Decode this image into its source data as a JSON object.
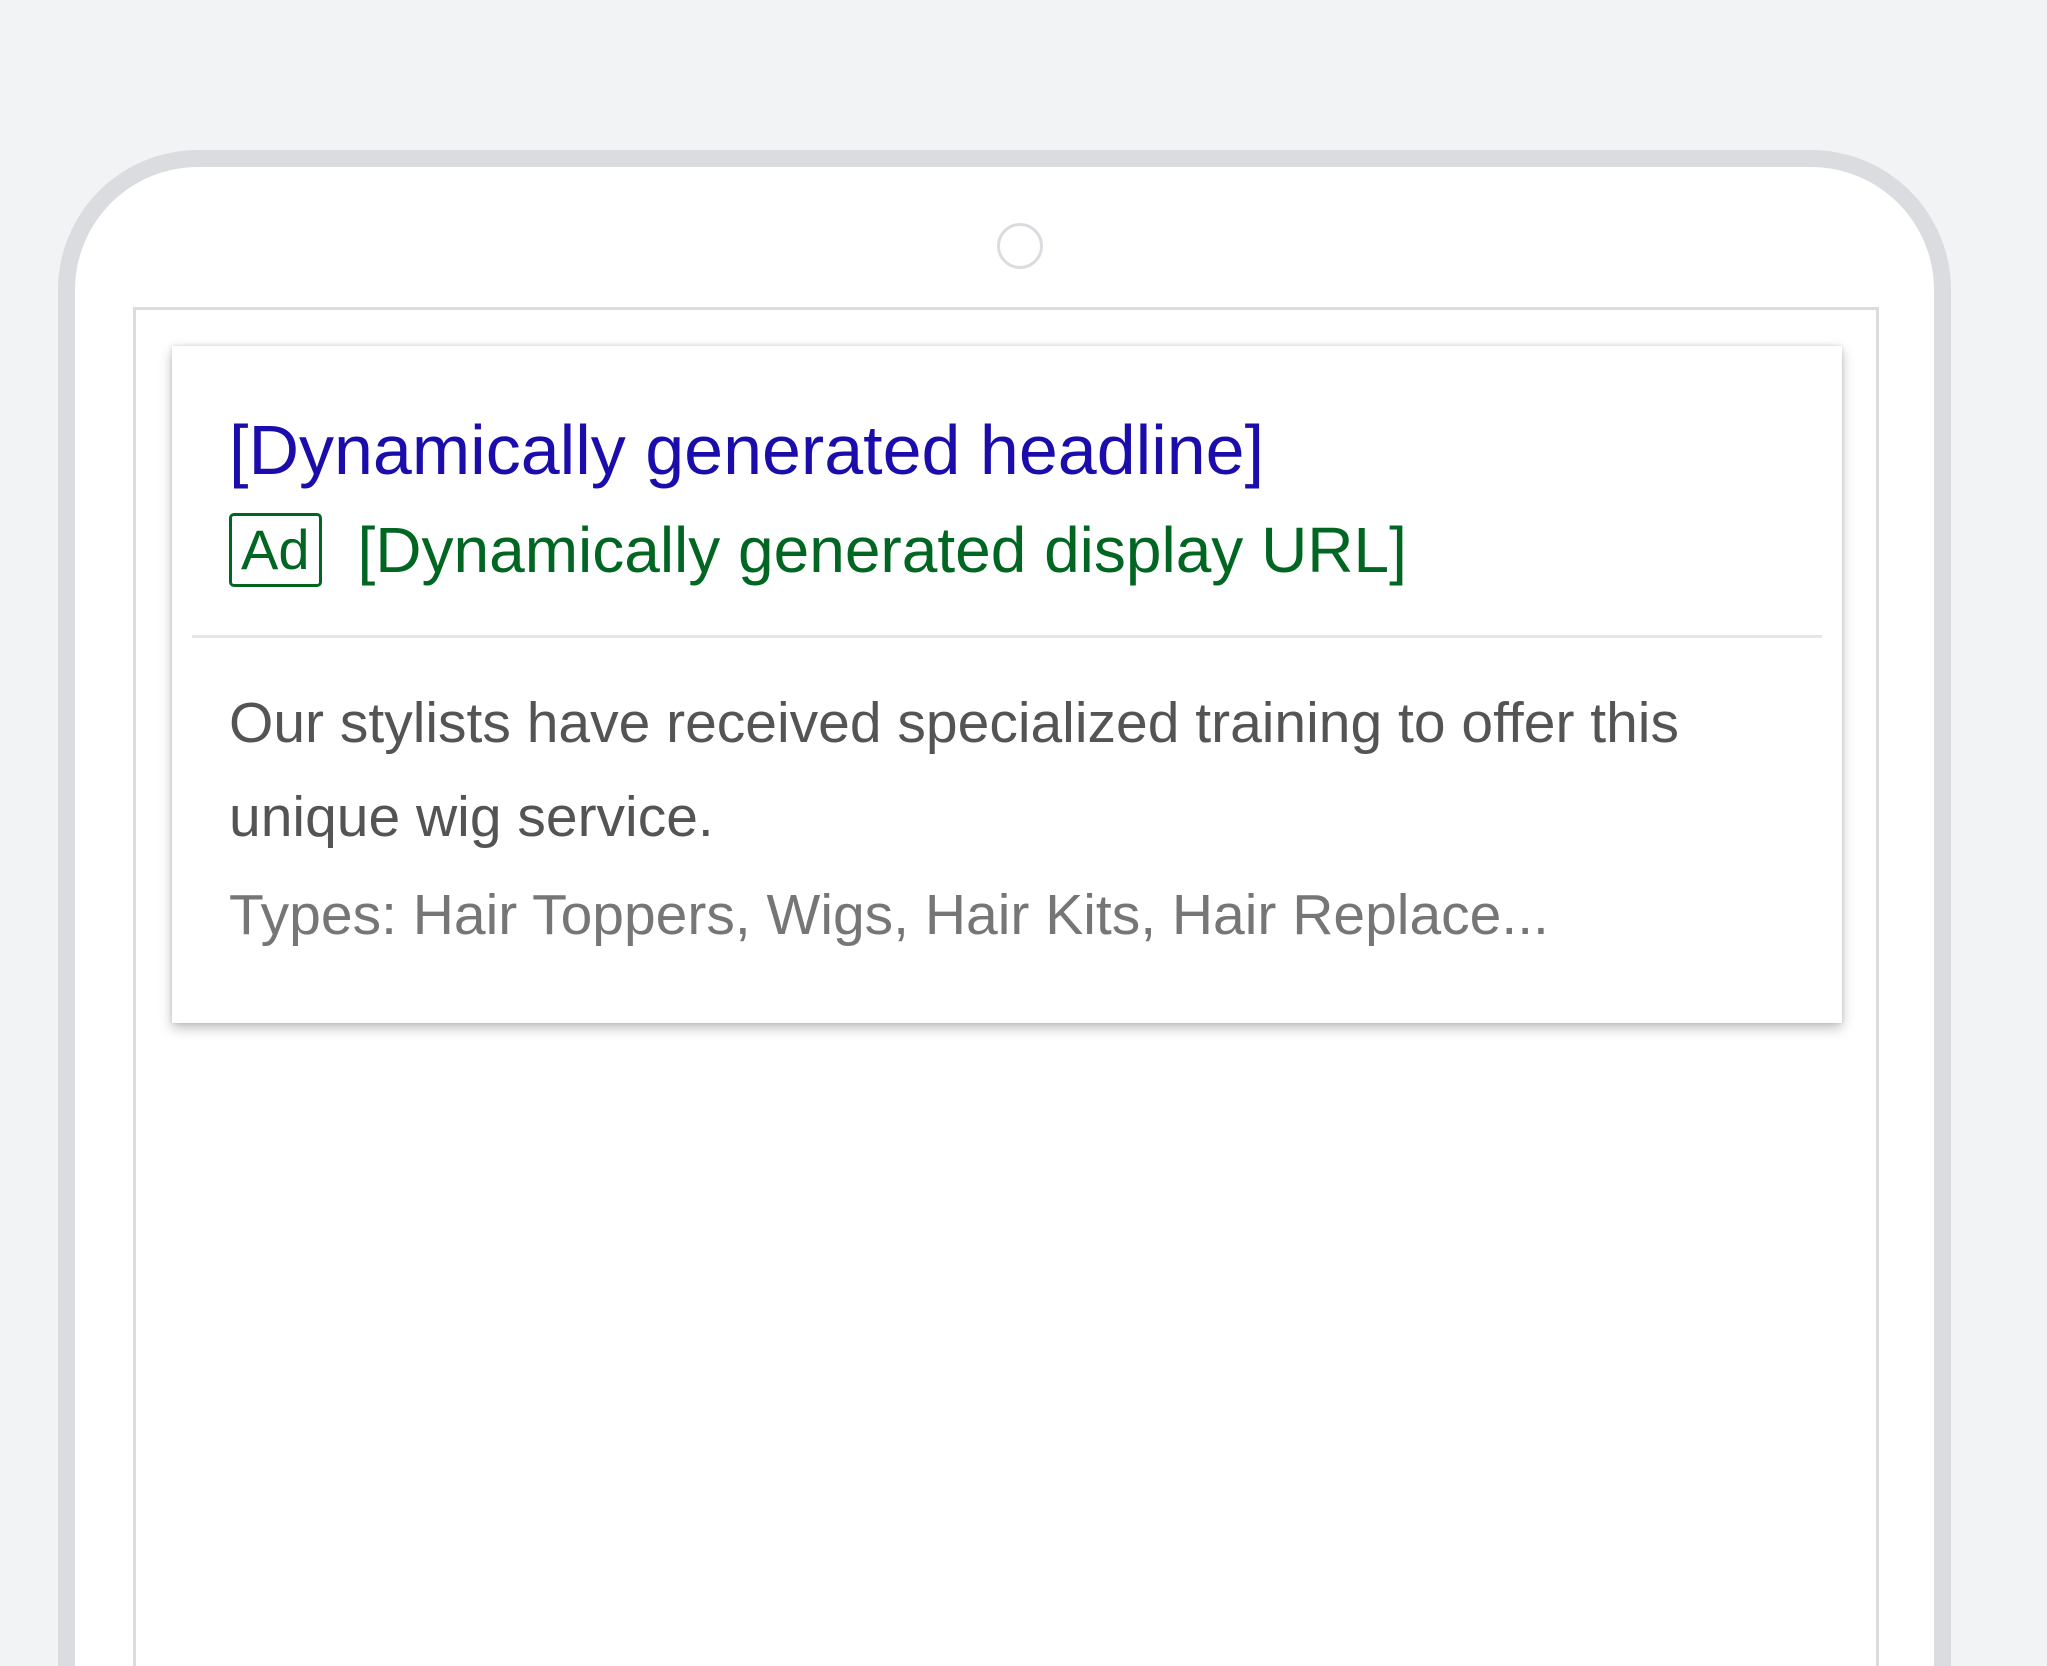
{
  "ad": {
    "headline": "[Dynamically generated headline]",
    "badge": "Ad",
    "display_url": "[Dynamically generated display URL]",
    "description": "Our stylists have received specialized training to offer this unique wig service.",
    "extension": "Types: Hair Toppers, Wigs, Hair Kits, Hair Replace..."
  },
  "colors": {
    "headline": "#1a0dab",
    "url": "#006621",
    "description": "#545454",
    "extension": "#767676",
    "frame": "#dadce0",
    "background": "#f1f3f4"
  }
}
